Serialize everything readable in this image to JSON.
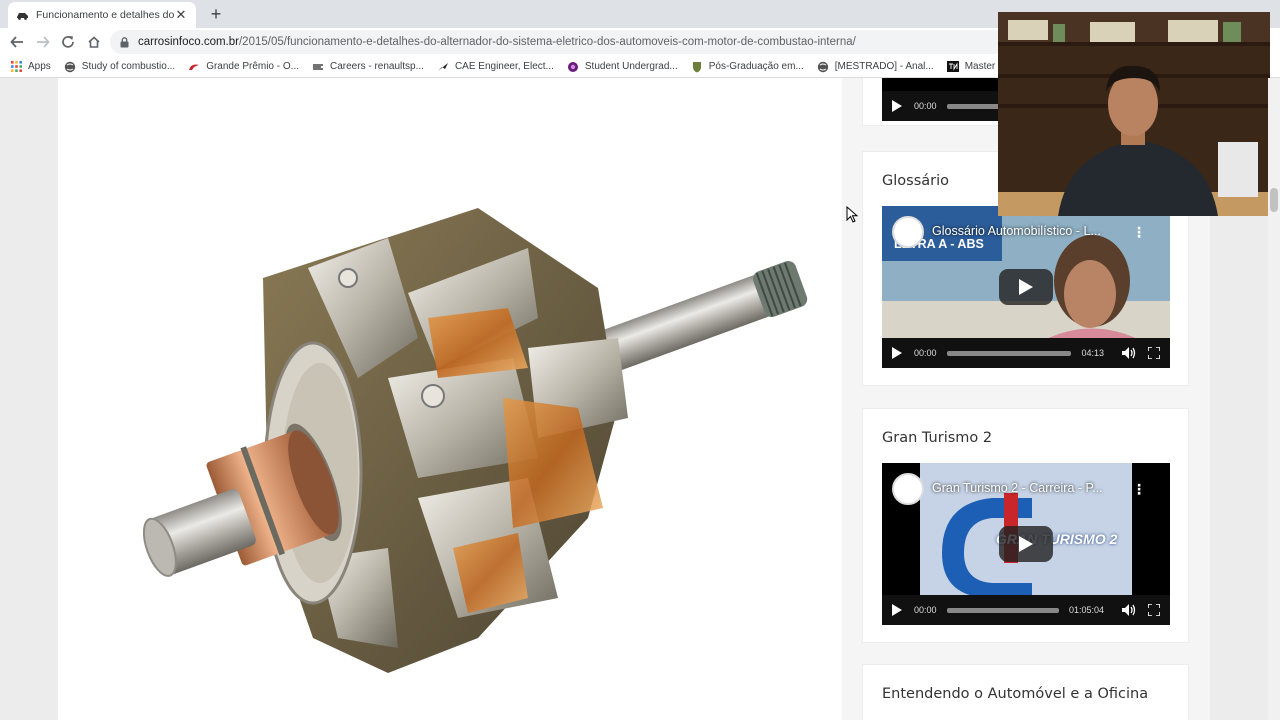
{
  "browser": {
    "tab_title": "Funcionamento e detalhes do alt",
    "url_domain": "carrosinfoco.com.br",
    "url_path": "/2015/05/funcionamento-e-detalhes-do-alternador-do-sistema-eletrico-dos-automoveis-com-motor-de-combustao-interna/",
    "bookmarks": [
      {
        "label": "Apps",
        "icon": "apps-grid-icon"
      },
      {
        "label": "Study of combustio...",
        "icon": "globe-icon"
      },
      {
        "label": "Grande Prêmio - O...",
        "icon": "gp-logo-icon"
      },
      {
        "label": "Careers - renaultsp...",
        "icon": "renault-icon"
      },
      {
        "label": "CAE Engineer, Elect...",
        "icon": "arrow-logo-icon"
      },
      {
        "label": "Student Undergrad...",
        "icon": "purple-circle-icon"
      },
      {
        "label": "Pós-Graduação em...",
        "icon": "crest-icon"
      },
      {
        "label": "[MESTRADO] - Anal...",
        "icon": "globe-icon"
      },
      {
        "label": "Master / Bachelor",
        "icon": "tno-icon"
      }
    ]
  },
  "sidebar": {
    "top_video": {
      "current_time": "00:00"
    },
    "widgets": [
      {
        "title": "Glossário",
        "video_title": "Glossário Automobilístico - L...",
        "thumb_text": "LETRA A - ABS",
        "current_time": "00:00",
        "duration": "04:13"
      },
      {
        "title": "Gran Turismo 2",
        "video_title": "Gran Turismo 2 - Carreira - P...",
        "thumb_text": "GRAN TURISMO 2",
        "current_time": "00:00",
        "duration": "01:05:04"
      },
      {
        "title": "Entendendo o Automóvel e a Oficina"
      }
    ]
  },
  "colors": {
    "page_bg": "#ececec",
    "card_bg": "#ffffff",
    "copper": "#c87b4f",
    "steel": "#b9b4a8"
  }
}
